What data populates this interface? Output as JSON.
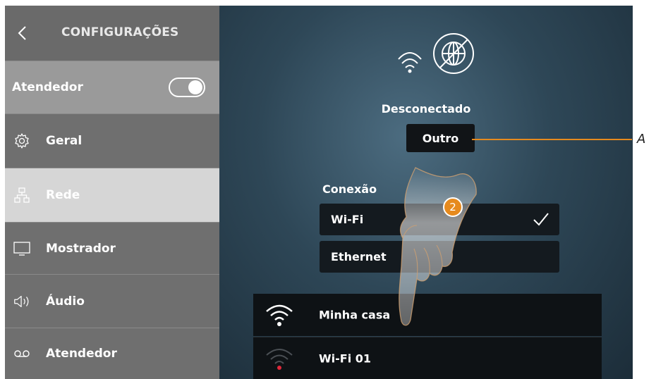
{
  "sidebar": {
    "title": "CONFIGURAÇÕES",
    "attendant": {
      "label": "Atendedor",
      "toggle_on": true
    },
    "items": [
      {
        "label": "Geral",
        "icon": "gear-icon"
      },
      {
        "label": "Rede",
        "icon": "network-icon",
        "active": true
      },
      {
        "label": "Mostrador",
        "icon": "monitor-icon"
      },
      {
        "label": "Áudio",
        "icon": "speaker-icon"
      },
      {
        "label": "Atendedor",
        "icon": "voicemail-icon"
      }
    ]
  },
  "main": {
    "status": "Desconectado",
    "other_button": "Outro",
    "connection_label": "Conexão",
    "connection_options": [
      {
        "label": "Wi-Fi",
        "selected": true
      },
      {
        "label": "Ethernet",
        "selected": false
      }
    ],
    "networks": [
      {
        "name": "Minha casa",
        "signal": "connected"
      },
      {
        "name": "Wi-Fi 01",
        "signal": "unavailable"
      }
    ]
  },
  "annotation": {
    "step": "2",
    "callout": "A"
  },
  "colors": {
    "accent": "#e68a1e",
    "sidebar_bg": "#6f6f6f",
    "active_item": "#d6d6d6",
    "main_bg": "#2e4757"
  }
}
